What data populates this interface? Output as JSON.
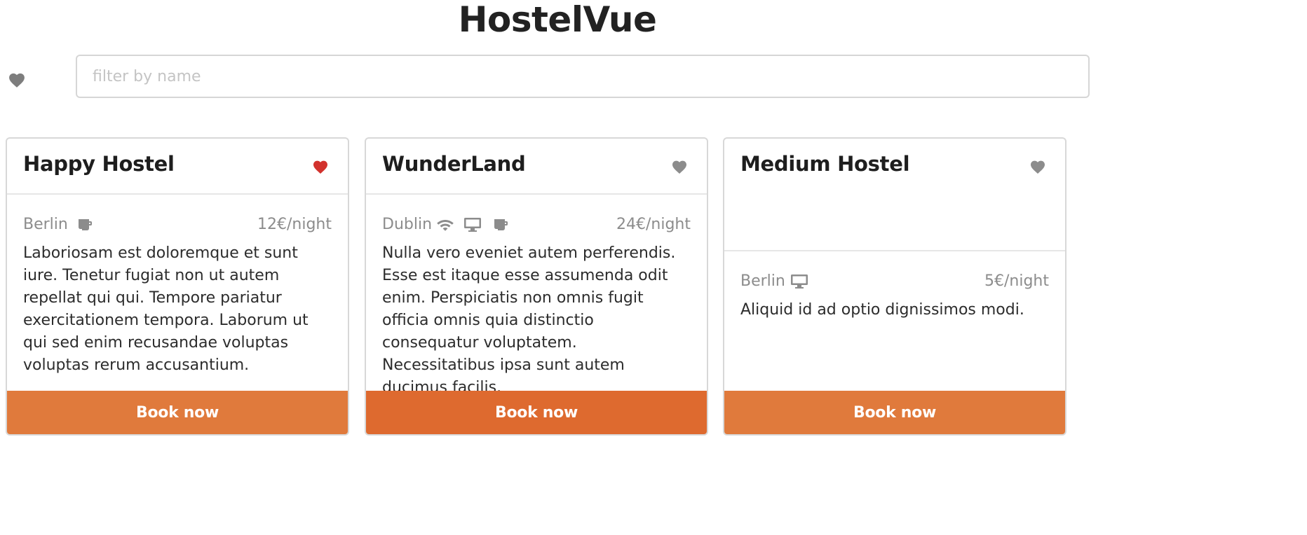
{
  "app": {
    "title": "HostelVue"
  },
  "filter": {
    "placeholder": "filter by name",
    "value": "",
    "favorites_only": false
  },
  "colors": {
    "accent": "#E07A3C",
    "accent_active": "#DE6A2F",
    "heart_active": "#D2322D",
    "heart_inactive": "#8C8C8C",
    "muted_text": "#8C8C8C"
  },
  "hostels": [
    {
      "name": "Happy Hostel",
      "favorite": true,
      "location": "Berlin",
      "amenities": [
        "breakfast-icon"
      ],
      "price": "12€/night",
      "description": "Laboriosam est doloremque et sunt iure. Tenetur fugiat non ut autem repellat qui qui. Tempore pariatur exercitationem tempora. Laborum ut qui sed enim recusandae voluptas voluptas rerum accusantium.",
      "button_label": "Book now"
    },
    {
      "name": "WunderLand",
      "favorite": false,
      "location": "Dublin",
      "amenities": [
        "wifi-icon",
        "computer-icon",
        "breakfast-icon"
      ],
      "price": "24€/night",
      "description": "Nulla vero eveniet autem perferendis. Esse est itaque esse assumenda odit enim. Perspiciatis non omnis fugit officia omnis quia distinctio consequatur voluptatem. Necessitatibus ipsa sunt autem ducimus facilis.",
      "button_label": "Book now"
    },
    {
      "name": "Medium Hostel",
      "favorite": false,
      "location": "Berlin",
      "amenities": [
        "computer-icon"
      ],
      "price": "5€/night",
      "description": "Aliquid id ad optio dignissimos modi.",
      "button_label": "Book now"
    }
  ]
}
